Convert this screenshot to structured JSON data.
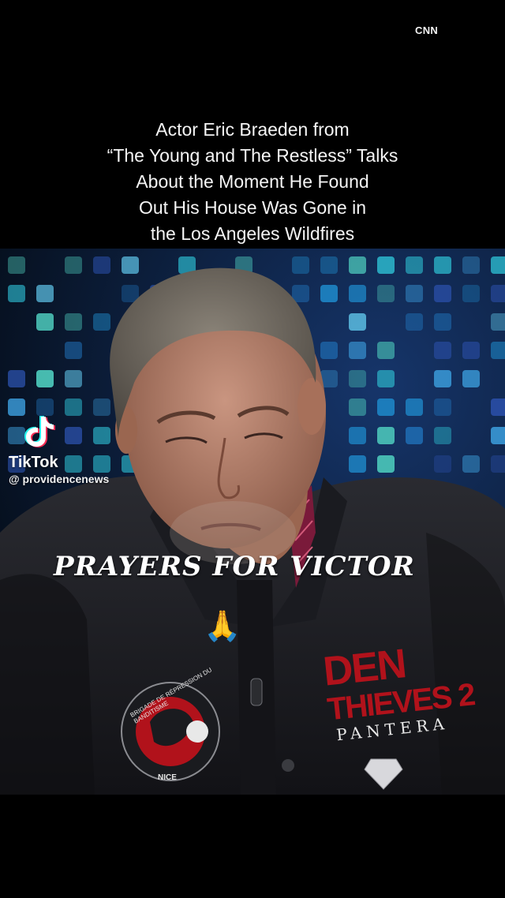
{
  "overlay": {
    "network_badge": "CNN",
    "headline_lines": [
      "Actor Eric Braeden from",
      "“The Young and The Restless” Talks",
      "About the Moment He Found",
      "Out His House Was Gone in",
      "the Los Angeles Wildfires"
    ],
    "caption": "PRAYERS FOR VICTOR",
    "emoji": "🙏"
  },
  "watermark": {
    "brand": "TikTok",
    "handle": "@ providencenews",
    "icon": "tiktok-logo-icon"
  },
  "jacket": {
    "patch_right_line1": "DEN",
    "patch_right_line2": "THIEVES 2",
    "patch_right_sub": "PANTERA",
    "patch_left_text": "BRIGADE DE RÉPRESSION DU BANDITISME",
    "patch_left_bottom": "NICE",
    "patch_left_letters": "BRB"
  },
  "colors": {
    "background": "#000000",
    "led_backdrop": "#0a1c3c",
    "jacket": "#1b1c20",
    "patch_red": "#b1121b"
  }
}
